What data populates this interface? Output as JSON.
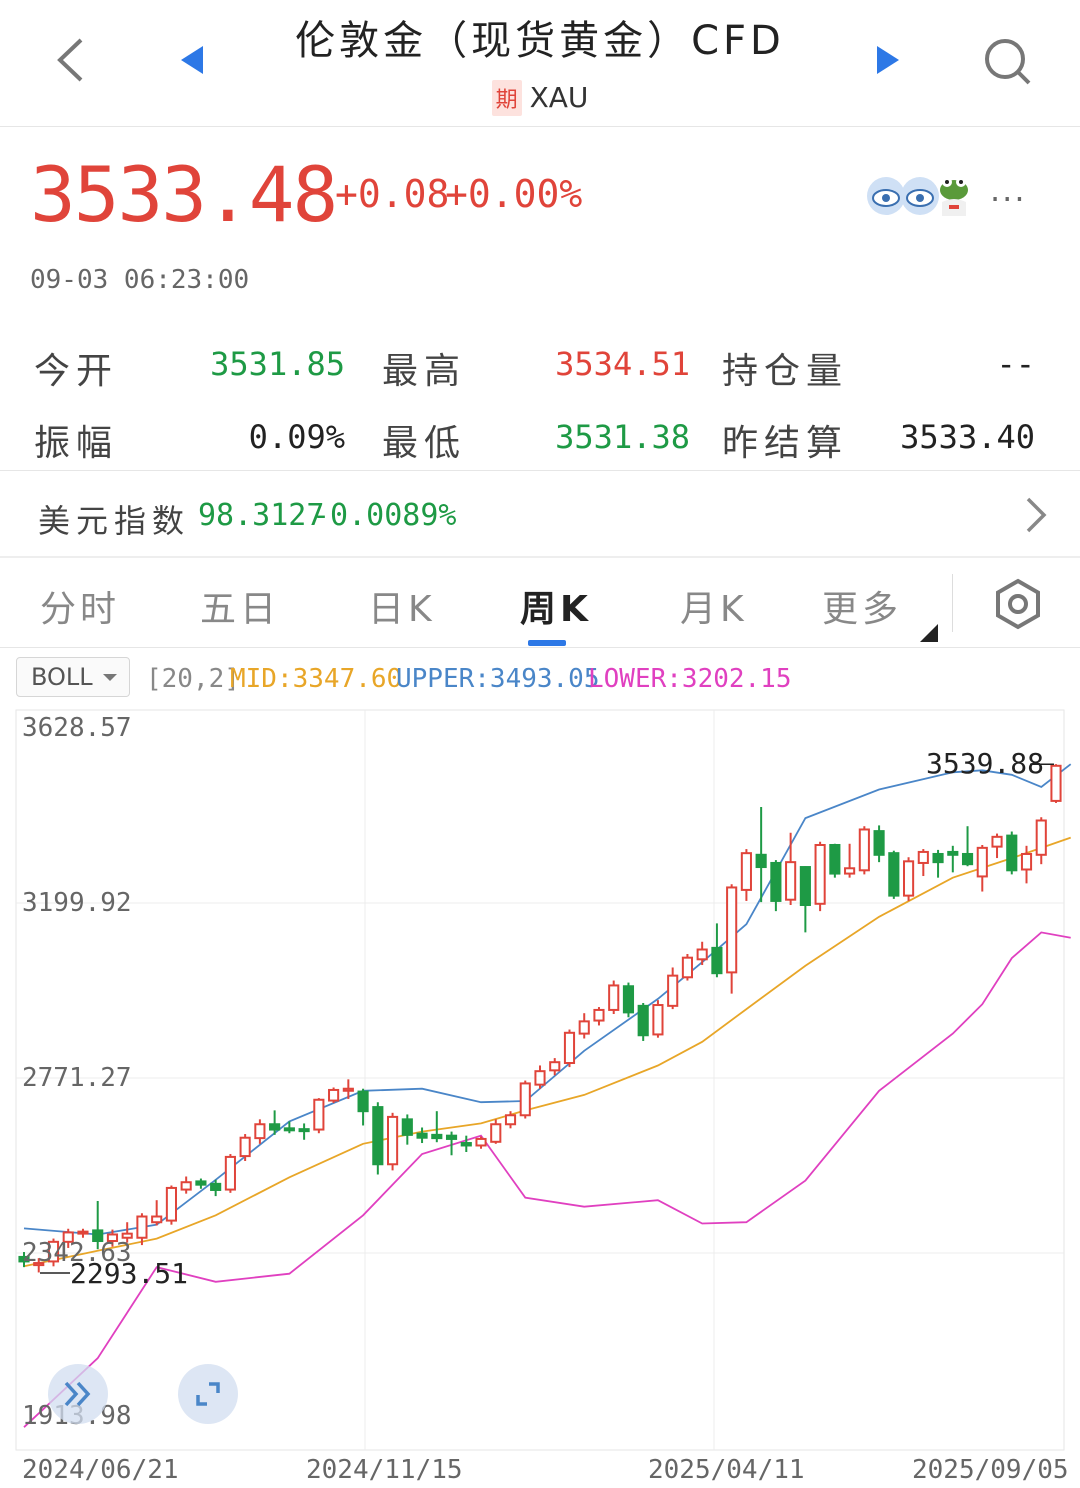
{
  "header": {
    "title": "伦敦金（现货黄金）CFD",
    "badge": "期",
    "symbol": "XAU",
    "back_icon": "chevron-left-icon",
    "prev_icon": "triangle-left-icon",
    "next_icon": "triangle-right-icon",
    "search_icon": "search-icon"
  },
  "quote": {
    "price": "3533.48",
    "change": "+0.08",
    "change_pct": "+0.00%",
    "time": "09-03 06:23:00",
    "more": "···"
  },
  "stats": [
    {
      "label": "今开",
      "value": "3531.85",
      "color": "#1e9a45"
    },
    {
      "label": "最高",
      "value": "3534.51",
      "color": "#e0443a"
    },
    {
      "label": "持仓量",
      "value": "--",
      "color": "#222222"
    },
    {
      "label": "振幅",
      "value": "0.09%",
      "color": "#222222"
    },
    {
      "label": "最低",
      "value": "3531.38",
      "color": "#1e9a45"
    },
    {
      "label": "昨结算",
      "value": "3533.40",
      "color": "#222222"
    }
  ],
  "dxy": {
    "label": "美元指数",
    "value": "98.3127",
    "change": "-0.0089%"
  },
  "tabs": [
    {
      "label": "分时",
      "active": false
    },
    {
      "label": "五日",
      "active": false
    },
    {
      "label": "日K",
      "active": false
    },
    {
      "label": "周K",
      "active": true
    },
    {
      "label": "月K",
      "active": false
    },
    {
      "label": "更多",
      "active": false
    }
  ],
  "indicator": {
    "select": "BOLL",
    "params": "[20,2]",
    "mid": "MID:3347.60",
    "upper": "UPPER:3493.05",
    "lower": "LOWER:3202.15"
  },
  "colors": {
    "up": "#e0443a",
    "down": "#1e9a45",
    "mid": "#e8a628",
    "upper": "#4a86c8",
    "lower": "#e040c0",
    "accent": "#2d78e6"
  },
  "chart_data": {
    "type": "candlestick",
    "y_ticks": [
      "3628.57",
      "3199.92",
      "2771.27",
      "2342.63",
      "1913.98"
    ],
    "x_ticks": [
      "2024/06/21",
      "2024/11/15",
      "2025/04/11",
      "2025/09/05"
    ],
    "ylim": [
      1913.98,
      3628.57
    ],
    "max_label": "3539.88",
    "min_label": "2293.51",
    "candles": [
      {
        "o": 2333,
        "c": 2322,
        "h": 2345,
        "l": 2308
      },
      {
        "o": 2313,
        "c": 2318,
        "h": 2330,
        "l": 2295
      },
      {
        "o": 2322,
        "c": 2370,
        "h": 2378,
        "l": 2310
      },
      {
        "o": 2370,
        "c": 2393,
        "h": 2402,
        "l": 2355
      },
      {
        "o": 2392,
        "c": 2395,
        "h": 2402,
        "l": 2380
      },
      {
        "o": 2398,
        "c": 2372,
        "h": 2470,
        "l": 2352
      },
      {
        "o": 2372,
        "c": 2388,
        "h": 2400,
        "l": 2358
      },
      {
        "o": 2380,
        "c": 2390,
        "h": 2418,
        "l": 2368
      },
      {
        "o": 2380,
        "c": 2432,
        "h": 2440,
        "l": 2362
      },
      {
        "o": 2418,
        "c": 2432,
        "h": 2472,
        "l": 2410
      },
      {
        "o": 2422,
        "c": 2502,
        "h": 2508,
        "l": 2412
      },
      {
        "o": 2498,
        "c": 2516,
        "h": 2530,
        "l": 2488
      },
      {
        "o": 2518,
        "c": 2510,
        "h": 2525,
        "l": 2500
      },
      {
        "o": 2512,
        "c": 2497,
        "h": 2522,
        "l": 2482
      },
      {
        "o": 2498,
        "c": 2578,
        "h": 2585,
        "l": 2490
      },
      {
        "o": 2580,
        "c": 2625,
        "h": 2634,
        "l": 2568
      },
      {
        "o": 2624,
        "c": 2658,
        "h": 2670,
        "l": 2610
      },
      {
        "o": 2658,
        "c": 2645,
        "h": 2692,
        "l": 2632
      },
      {
        "o": 2648,
        "c": 2645,
        "h": 2665,
        "l": 2636
      },
      {
        "o": 2646,
        "c": 2645,
        "h": 2660,
        "l": 2620
      },
      {
        "o": 2645,
        "c": 2718,
        "h": 2722,
        "l": 2636
      },
      {
        "o": 2716,
        "c": 2742,
        "h": 2748,
        "l": 2710
      },
      {
        "o": 2740,
        "c": 2745,
        "h": 2768,
        "l": 2720
      },
      {
        "o": 2738,
        "c": 2690,
        "h": 2745,
        "l": 2655
      },
      {
        "o": 2700,
        "c": 2560,
        "h": 2712,
        "l": 2535
      },
      {
        "o": 2560,
        "c": 2676,
        "h": 2686,
        "l": 2545
      },
      {
        "o": 2670,
        "c": 2632,
        "h": 2682,
        "l": 2608
      },
      {
        "o": 2635,
        "c": 2625,
        "h": 2650,
        "l": 2612
      },
      {
        "o": 2632,
        "c": 2624,
        "h": 2690,
        "l": 2614
      },
      {
        "o": 2630,
        "c": 2622,
        "h": 2640,
        "l": 2582
      },
      {
        "o": 2612,
        "c": 2606,
        "h": 2630,
        "l": 2590
      },
      {
        "o": 2606,
        "c": 2622,
        "h": 2628,
        "l": 2598
      },
      {
        "o": 2615,
        "c": 2658,
        "h": 2670,
        "l": 2610
      },
      {
        "o": 2658,
        "c": 2680,
        "h": 2690,
        "l": 2648
      },
      {
        "o": 2680,
        "c": 2758,
        "h": 2765,
        "l": 2672
      },
      {
        "o": 2755,
        "c": 2788,
        "h": 2802,
        "l": 2745
      },
      {
        "o": 2790,
        "c": 2810,
        "h": 2820,
        "l": 2778
      },
      {
        "o": 2808,
        "c": 2882,
        "h": 2890,
        "l": 2798
      },
      {
        "o": 2880,
        "c": 2910,
        "h": 2930,
        "l": 2868
      },
      {
        "o": 2912,
        "c": 2938,
        "h": 2945,
        "l": 2900
      },
      {
        "o": 2938,
        "c": 2998,
        "h": 3010,
        "l": 2928
      },
      {
        "o": 2996,
        "c": 2932,
        "h": 3005,
        "l": 2920
      },
      {
        "o": 2948,
        "c": 2876,
        "h": 2955,
        "l": 2862
      },
      {
        "o": 2878,
        "c": 2950,
        "h": 2962,
        "l": 2870
      },
      {
        "o": 2948,
        "c": 3022,
        "h": 3042,
        "l": 2940
      },
      {
        "o": 3018,
        "c": 3066,
        "h": 3075,
        "l": 3010
      },
      {
        "o": 3062,
        "c": 3086,
        "h": 3105,
        "l": 3048
      },
      {
        "o": 3090,
        "c": 3028,
        "h": 3150,
        "l": 3018
      },
      {
        "o": 3030,
        "c": 3238,
        "h": 3246,
        "l": 2978
      },
      {
        "o": 3232,
        "c": 3322,
        "h": 3332,
        "l": 3205
      },
      {
        "o": 3318,
        "c": 3288,
        "h": 3435,
        "l": 3202
      },
      {
        "o": 3298,
        "c": 3205,
        "h": 3305,
        "l": 3180
      },
      {
        "o": 3208,
        "c": 3300,
        "h": 3372,
        "l": 3195
      },
      {
        "o": 3288,
        "c": 3195,
        "h": 3290,
        "l": 3128
      },
      {
        "o": 3198,
        "c": 3342,
        "h": 3350,
        "l": 3180
      },
      {
        "o": 3342,
        "c": 3272,
        "h": 3345,
        "l": 3262
      },
      {
        "o": 3272,
        "c": 3285,
        "h": 3345,
        "l": 3262
      },
      {
        "o": 3280,
        "c": 3380,
        "h": 3388,
        "l": 3270
      },
      {
        "o": 3376,
        "c": 3318,
        "h": 3390,
        "l": 3300
      },
      {
        "o": 3322,
        "c": 3218,
        "h": 3328,
        "l": 3210
      },
      {
        "o": 3218,
        "c": 3302,
        "h": 3312,
        "l": 3205
      },
      {
        "o": 3298,
        "c": 3325,
        "h": 3332,
        "l": 3266
      },
      {
        "o": 3320,
        "c": 3300,
        "h": 3330,
        "l": 3262
      },
      {
        "o": 3325,
        "c": 3318,
        "h": 3340,
        "l": 3275
      },
      {
        "o": 3320,
        "c": 3295,
        "h": 3388,
        "l": 3290
      },
      {
        "o": 3265,
        "c": 3335,
        "h": 3342,
        "l": 3228
      },
      {
        "o": 3338,
        "c": 3362,
        "h": 3370,
        "l": 3310
      },
      {
        "o": 3365,
        "c": 3280,
        "h": 3375,
        "l": 3270
      },
      {
        "o": 3282,
        "c": 3320,
        "h": 3340,
        "l": 3248
      },
      {
        "o": 3318,
        "c": 3402,
        "h": 3410,
        "l": 3295
      },
      {
        "o": 3450,
        "c": 3536,
        "h": 3540,
        "l": 3445
      }
    ],
    "upper": [
      [
        0,
        2403
      ],
      [
        5,
        2388
      ],
      [
        9,
        2412
      ],
      [
        13,
        2522
      ],
      [
        18,
        2665
      ],
      [
        23,
        2740
      ],
      [
        27,
        2745
      ],
      [
        31,
        2712
      ],
      [
        34,
        2715
      ],
      [
        38,
        2838
      ],
      [
        43,
        2965
      ],
      [
        46,
        3055
      ],
      [
        49,
        3148
      ],
      [
        53,
        3408
      ],
      [
        58,
        3478
      ],
      [
        63,
        3520
      ],
      [
        65,
        3525
      ],
      [
        67,
        3514
      ],
      [
        69,
        3484
      ],
      [
        71,
        3540
      ]
    ],
    "mid": [
      [
        0,
        2310
      ],
      [
        5,
        2348
      ],
      [
        9,
        2378
      ],
      [
        13,
        2435
      ],
      [
        18,
        2528
      ],
      [
        23,
        2610
      ],
      [
        27,
        2640
      ],
      [
        31,
        2660
      ],
      [
        34,
        2692
      ],
      [
        38,
        2730
      ],
      [
        43,
        2802
      ],
      [
        46,
        2860
      ],
      [
        49,
        2940
      ],
      [
        53,
        3046
      ],
      [
        58,
        3166
      ],
      [
        63,
        3262
      ],
      [
        65,
        3286
      ],
      [
        67,
        3310
      ],
      [
        69,
        3335
      ],
      [
        71,
        3360
      ]
    ],
    "lower": [
      [
        0,
        1916
      ],
      [
        5,
        2085
      ],
      [
        9,
        2308
      ],
      [
        13,
        2272
      ],
      [
        18,
        2292
      ],
      [
        23,
        2435
      ],
      [
        27,
        2585
      ],
      [
        31,
        2630
      ],
      [
        34,
        2478
      ],
      [
        38,
        2456
      ],
      [
        43,
        2472
      ],
      [
        46,
        2415
      ],
      [
        49,
        2418
      ],
      [
        53,
        2520
      ],
      [
        58,
        2740
      ],
      [
        63,
        2880
      ],
      [
        65,
        2952
      ],
      [
        67,
        3065
      ],
      [
        69,
        3128
      ],
      [
        71,
        3115
      ]
    ]
  }
}
